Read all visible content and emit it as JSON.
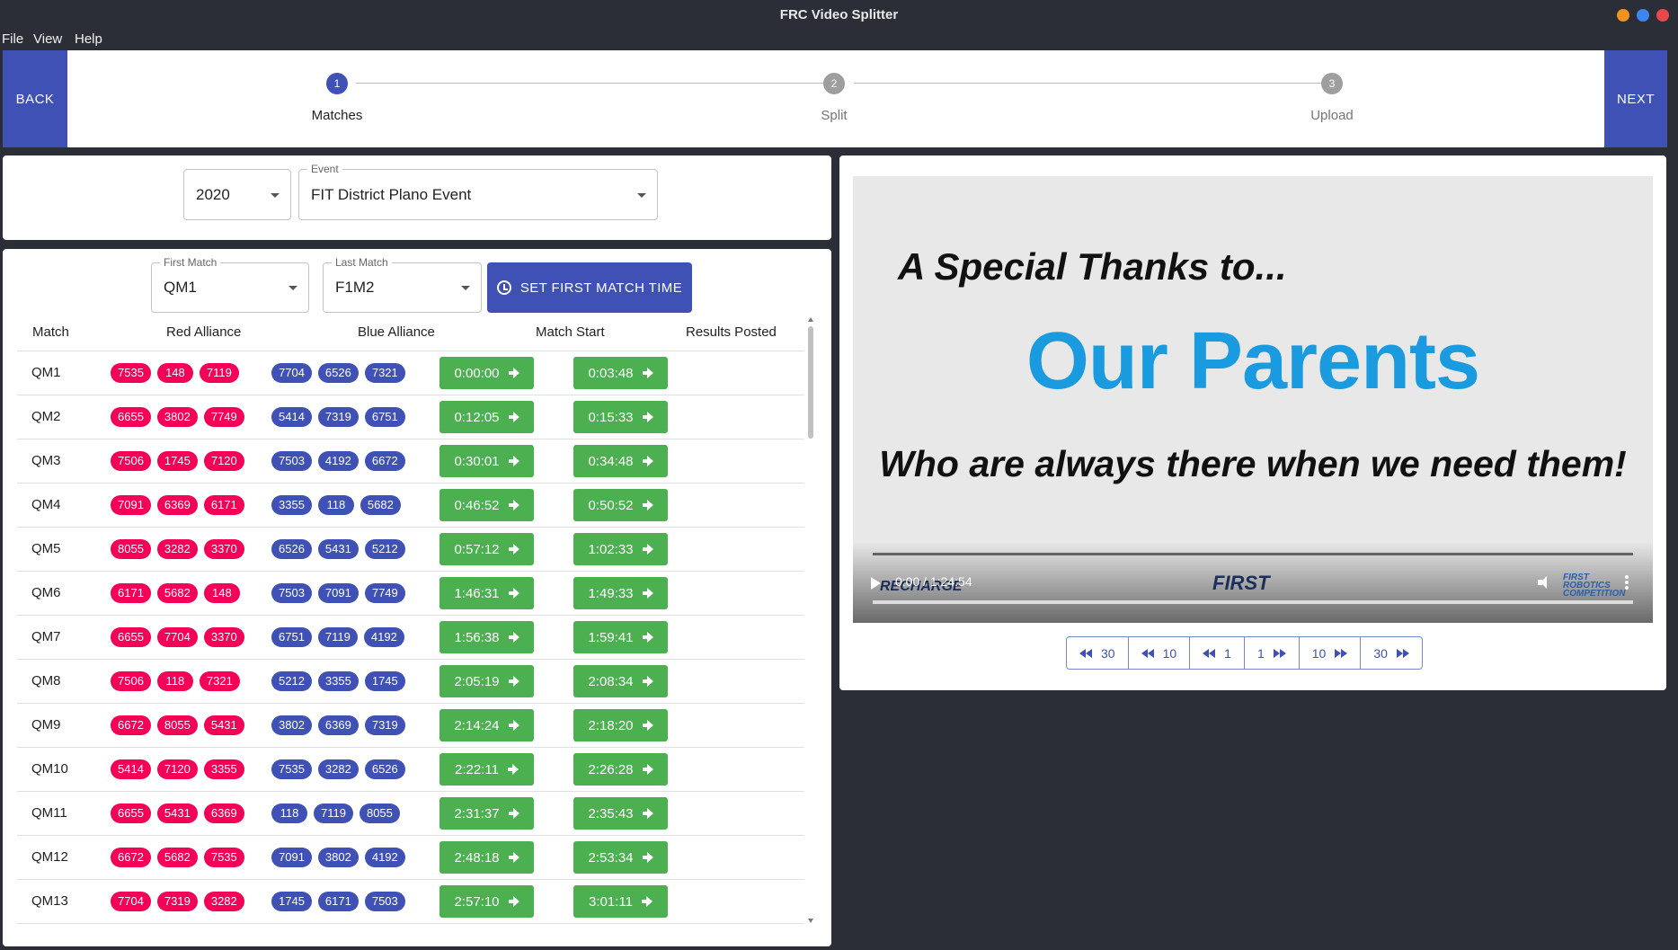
{
  "window": {
    "title": "FRC Video Splitter"
  },
  "menu": {
    "file": "File",
    "view": "View",
    "help": "Help"
  },
  "nav": {
    "back": "BACK",
    "next": "NEXT"
  },
  "steps": [
    {
      "num": "1",
      "label": "Matches",
      "active": true
    },
    {
      "num": "2",
      "label": "Split",
      "active": false
    },
    {
      "num": "3",
      "label": "Upload",
      "active": false
    }
  ],
  "event_form": {
    "year": "2020",
    "event_label": "Event",
    "event_value": "FIT District Plano Event"
  },
  "match_form": {
    "first_label": "First Match",
    "first_value": "QM1",
    "last_label": "Last Match",
    "last_value": "F1M2",
    "set_time_label": "SET FIRST MATCH TIME"
  },
  "table": {
    "headers": {
      "match": "Match",
      "red": "Red Alliance",
      "blue": "Blue Alliance",
      "start": "Match Start",
      "posted": "Results Posted"
    },
    "rows": [
      {
        "match": "QM1",
        "red": [
          "7535",
          "148",
          "7119"
        ],
        "blue": [
          "7704",
          "6526",
          "7321"
        ],
        "start": "0:00:00",
        "posted": "0:03:48"
      },
      {
        "match": "QM2",
        "red": [
          "6655",
          "3802",
          "7749"
        ],
        "blue": [
          "5414",
          "7319",
          "6751"
        ],
        "start": "0:12:05",
        "posted": "0:15:33"
      },
      {
        "match": "QM3",
        "red": [
          "7506",
          "1745",
          "7120"
        ],
        "blue": [
          "7503",
          "4192",
          "6672"
        ],
        "start": "0:30:01",
        "posted": "0:34:48"
      },
      {
        "match": "QM4",
        "red": [
          "7091",
          "6369",
          "6171"
        ],
        "blue": [
          "3355",
          "118",
          "5682"
        ],
        "start": "0:46:52",
        "posted": "0:50:52"
      },
      {
        "match": "QM5",
        "red": [
          "8055",
          "3282",
          "3370"
        ],
        "blue": [
          "6526",
          "5431",
          "5212"
        ],
        "start": "0:57:12",
        "posted": "1:02:33"
      },
      {
        "match": "QM6",
        "red": [
          "6171",
          "5682",
          "148"
        ],
        "blue": [
          "7503",
          "7091",
          "7749"
        ],
        "start": "1:46:31",
        "posted": "1:49:33"
      },
      {
        "match": "QM7",
        "red": [
          "6655",
          "7704",
          "3370"
        ],
        "blue": [
          "6751",
          "7119",
          "4192"
        ],
        "start": "1:56:38",
        "posted": "1:59:41"
      },
      {
        "match": "QM8",
        "red": [
          "7506",
          "118",
          "7321"
        ],
        "blue": [
          "5212",
          "3355",
          "1745"
        ],
        "start": "2:05:19",
        "posted": "2:08:34"
      },
      {
        "match": "QM9",
        "red": [
          "6672",
          "8055",
          "5431"
        ],
        "blue": [
          "3802",
          "6369",
          "7319"
        ],
        "start": "2:14:24",
        "posted": "2:18:20"
      },
      {
        "match": "QM10",
        "red": [
          "5414",
          "7120",
          "3355"
        ],
        "blue": [
          "7535",
          "3282",
          "6526"
        ],
        "start": "2:22:11",
        "posted": "2:26:28"
      },
      {
        "match": "QM11",
        "red": [
          "6655",
          "5431",
          "6369"
        ],
        "blue": [
          "118",
          "7119",
          "8055"
        ],
        "start": "2:31:37",
        "posted": "2:35:43"
      },
      {
        "match": "QM12",
        "red": [
          "6672",
          "5682",
          "7535"
        ],
        "blue": [
          "7091",
          "3802",
          "4192"
        ],
        "start": "2:48:18",
        "posted": "2:53:34"
      },
      {
        "match": "QM13",
        "red": [
          "7704",
          "7319",
          "3282"
        ],
        "blue": [
          "1745",
          "6171",
          "7503"
        ],
        "start": "2:57:10",
        "posted": "3:01:11"
      }
    ]
  },
  "video": {
    "slide_line1": "A Special Thanks to...",
    "slide_line2": "Our Parents",
    "slide_line3": "Who are always there when we need them!",
    "time": "0:00 / 1:24:54",
    "logo_recharge": "RECHARGE",
    "logo_first": "FIRST",
    "logo_frc": "FIRST ROBOTICS COMPETITION"
  },
  "seek": {
    "back30": "30",
    "back10": "10",
    "back1": "1",
    "fwd1": "1",
    "fwd10": "10",
    "fwd30": "30"
  },
  "colors": {
    "primary": "#3f51b5",
    "red_chip": "#f50057",
    "green_btn": "#4caf50"
  }
}
